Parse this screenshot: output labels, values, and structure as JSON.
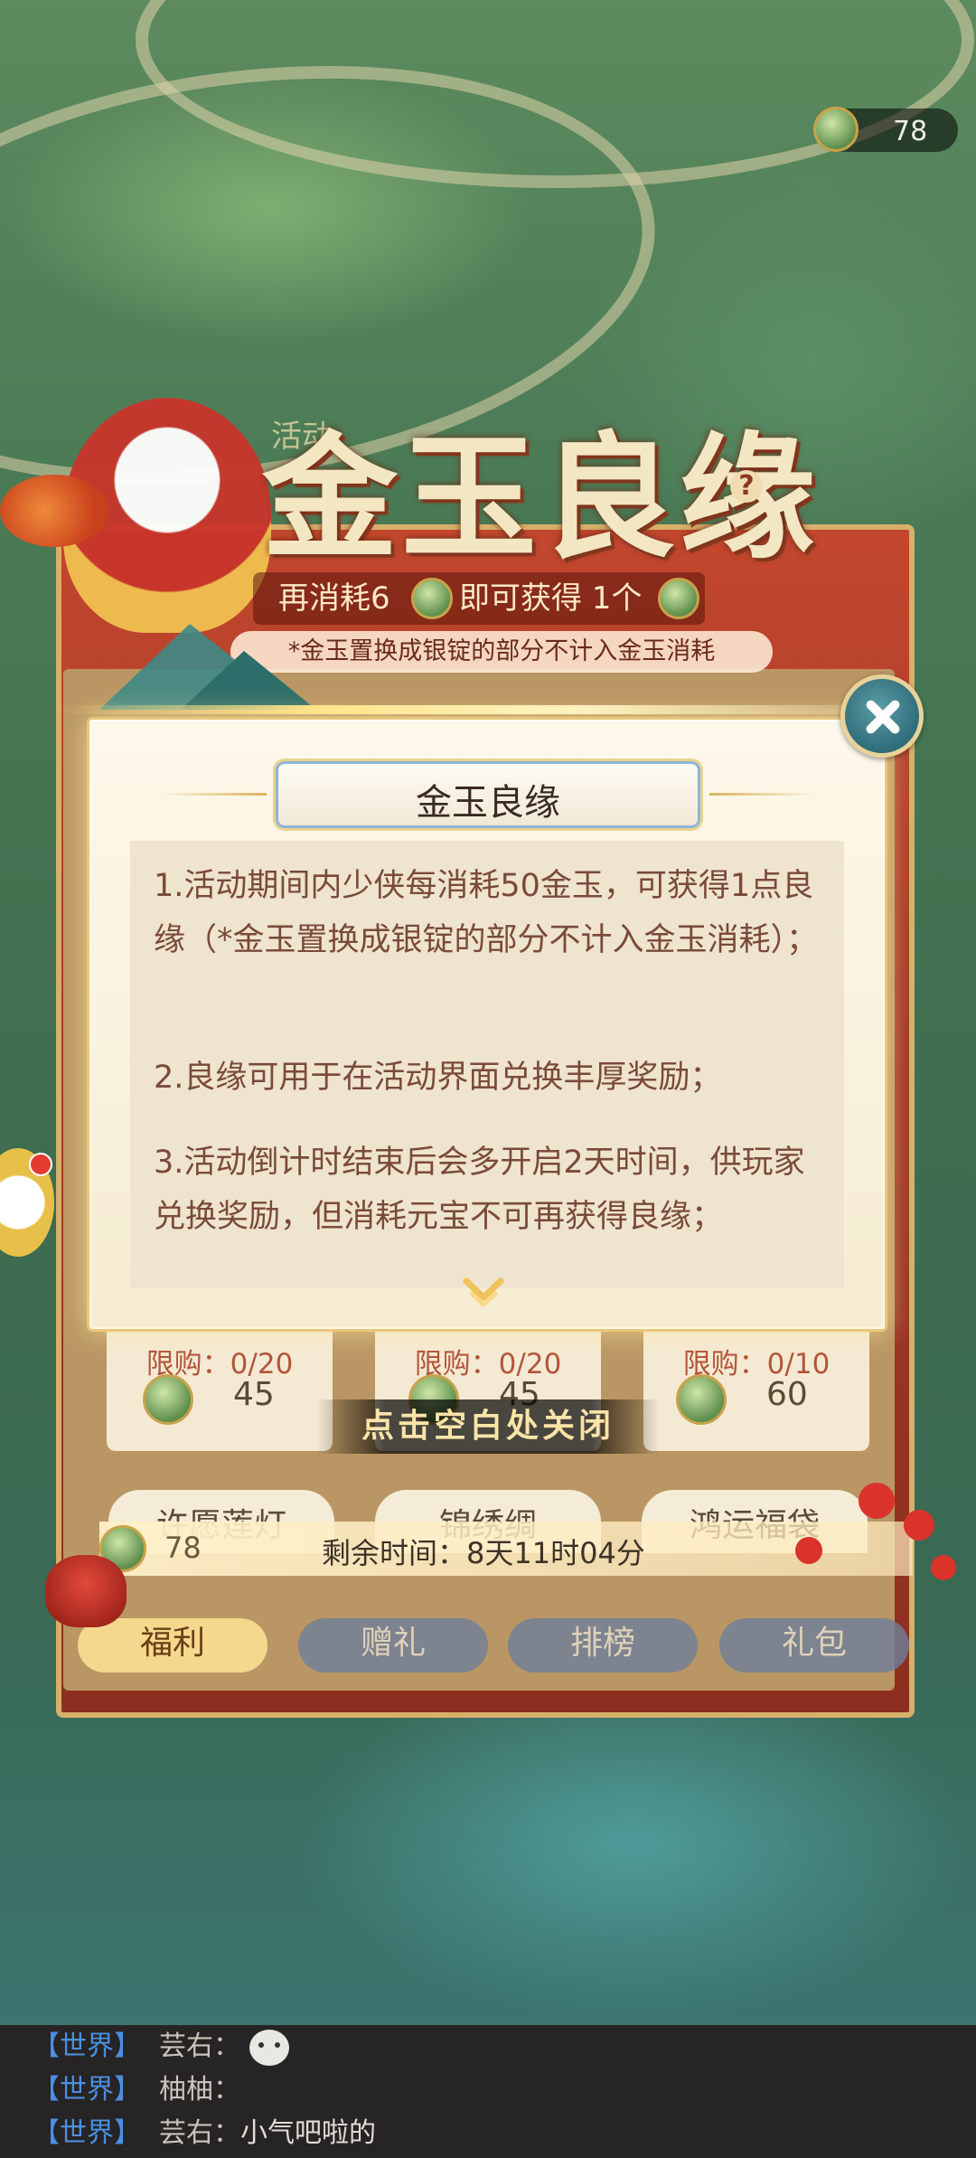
{
  "top_currency": {
    "value": "78"
  },
  "event": {
    "title": "金玉良缘",
    "small_label": "活动",
    "consume_prefix": "再消耗6",
    "consume_mid": "即可获得 1个",
    "note": "*金玉置换成银锭的部分不计入金玉消耗"
  },
  "dialog": {
    "title": "金玉良缘",
    "paragraphs": [
      "1.活动期间内少侠每消耗50金玉，可获得1点良缘（*金玉置换成银锭的部分不计入金玉消耗）；",
      "2.良缘可用于在活动界面兑换丰厚奖励；",
      "3.活动倒计时结束后会多开启2天时间，供玩家兑换奖励，但消耗元宝不可再获得良缘；"
    ]
  },
  "cards": [
    {
      "limit": "限购：0/20",
      "price": "45",
      "name": "许愿莲灯"
    },
    {
      "limit": "限购：0/20",
      "price": "45",
      "name": "锦绣绸"
    },
    {
      "limit": "限购：0/10",
      "price": "60",
      "name": "鸿运福袋"
    }
  ],
  "close_hint": "点击空白处关闭",
  "footer": {
    "currency": "78",
    "remaining_time": "剩余时间：8天11时04分"
  },
  "tabs": [
    "福利",
    "赠礼",
    "排榜",
    "礼包"
  ],
  "chat": [
    {
      "channel": "【世界】",
      "name": "芸右：",
      "message": ""
    },
    {
      "channel": "【世界】",
      "name": "柚柚：",
      "message": ""
    },
    {
      "channel": "【世界】",
      "name": "芸右：",
      "message": "小气吧啦的"
    }
  ],
  "icons": [
    "coin-icon",
    "help-icon",
    "close-icon",
    "chevron-down-icon",
    "chat-bubble-icon"
  ]
}
